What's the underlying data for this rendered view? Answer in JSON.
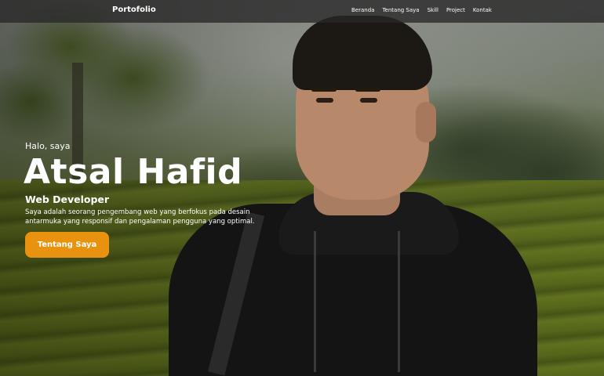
{
  "navbar": {
    "brand": "Portofolio",
    "links": [
      {
        "label": "Beranda"
      },
      {
        "label": "Tentang Saya"
      },
      {
        "label": "Skill"
      },
      {
        "label": "Project"
      },
      {
        "label": "Kontak"
      }
    ]
  },
  "hero": {
    "greeting": "Halo, saya",
    "name": "Atsal Hafid",
    "role": "Web Developer",
    "description": "Saya adalah seorang pengembang web yang berfokus pada desain antarmuka yang responsif dan pengalaman pengguna yang optimal.",
    "cta_label": "Tentang Saya"
  },
  "colors": {
    "accent": "#e8920f",
    "navbar_bg": "#282828",
    "text": "#ffffff"
  }
}
